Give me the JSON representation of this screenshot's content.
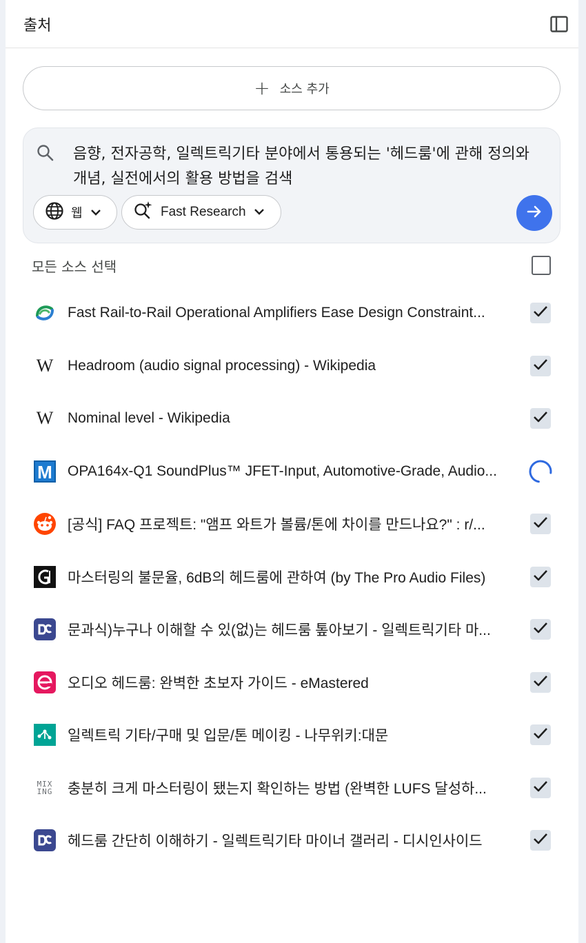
{
  "header": {
    "title": "출처"
  },
  "add_source": {
    "label": "소스 추가"
  },
  "search": {
    "query": "음향, 전자공학, 일렉트릭기타 분야에서 통용되는 '헤드룸'에 관해 정의와 개념, 실전에서의 활용 방법을 검색",
    "web_chip": "웹",
    "mode_chip": "Fast Research"
  },
  "select_all": {
    "label": "모든 소스 선택",
    "checked": false
  },
  "sources": [
    {
      "title": "Fast Rail-to-Rail Operational Amplifiers Ease Design Constraint...",
      "icon": "analog-logo-icon",
      "state": "checked"
    },
    {
      "title": "Headroom (audio signal processing) - Wikipedia",
      "icon": "wikipedia-icon",
      "state": "checked"
    },
    {
      "title": "Nominal level - Wikipedia",
      "icon": "wikipedia-icon",
      "state": "checked"
    },
    {
      "title": "OPA164x-Q1 SoundPlus™ JFET-Input, Automotive-Grade, Audio...",
      "icon": "mouser-icon",
      "state": "loading"
    },
    {
      "title": "[공식] FAQ 프로젝트: \"앰프 와트가 볼륨/톤에 차이를 만드나요?\" : r/...",
      "icon": "reddit-icon",
      "state": "checked"
    },
    {
      "title": "마스터링의 불문율, 6dB의 헤드룸에 관하여 (by The Pro Audio Files)",
      "icon": "pro-audio-files-icon",
      "state": "checked"
    },
    {
      "title": "문과식)누구나 이해할 수 있(없)는 헤드룸 톺아보기 - 일렉트릭기타 마...",
      "icon": "dcinside-icon",
      "state": "checked"
    },
    {
      "title": "오디오 헤드룸: 완벽한 초보자 가이드 - eMastered",
      "icon": "emastered-icon",
      "state": "checked"
    },
    {
      "title": "일렉트릭 기타/구매 및 입문/톤 메이킹 - 나무위키:대문",
      "icon": "namuwiki-icon",
      "state": "checked"
    },
    {
      "title": "충분히 크게 마스터링이 됐는지 확인하는 방법 (완벽한 LUFS 달성하...",
      "icon": "mixing-icon",
      "state": "checked"
    },
    {
      "title": "헤드룸 간단히 이해하기 - 일렉트릭기타 마이너 갤러리 - 디시인사이드",
      "icon": "dcinside-icon",
      "state": "checked"
    }
  ],
  "mixing_icon_text": [
    "MIX",
    "ING"
  ],
  "colors": {
    "accent": "#3f73ec",
    "checkbox_fill": "#dde3ea"
  }
}
